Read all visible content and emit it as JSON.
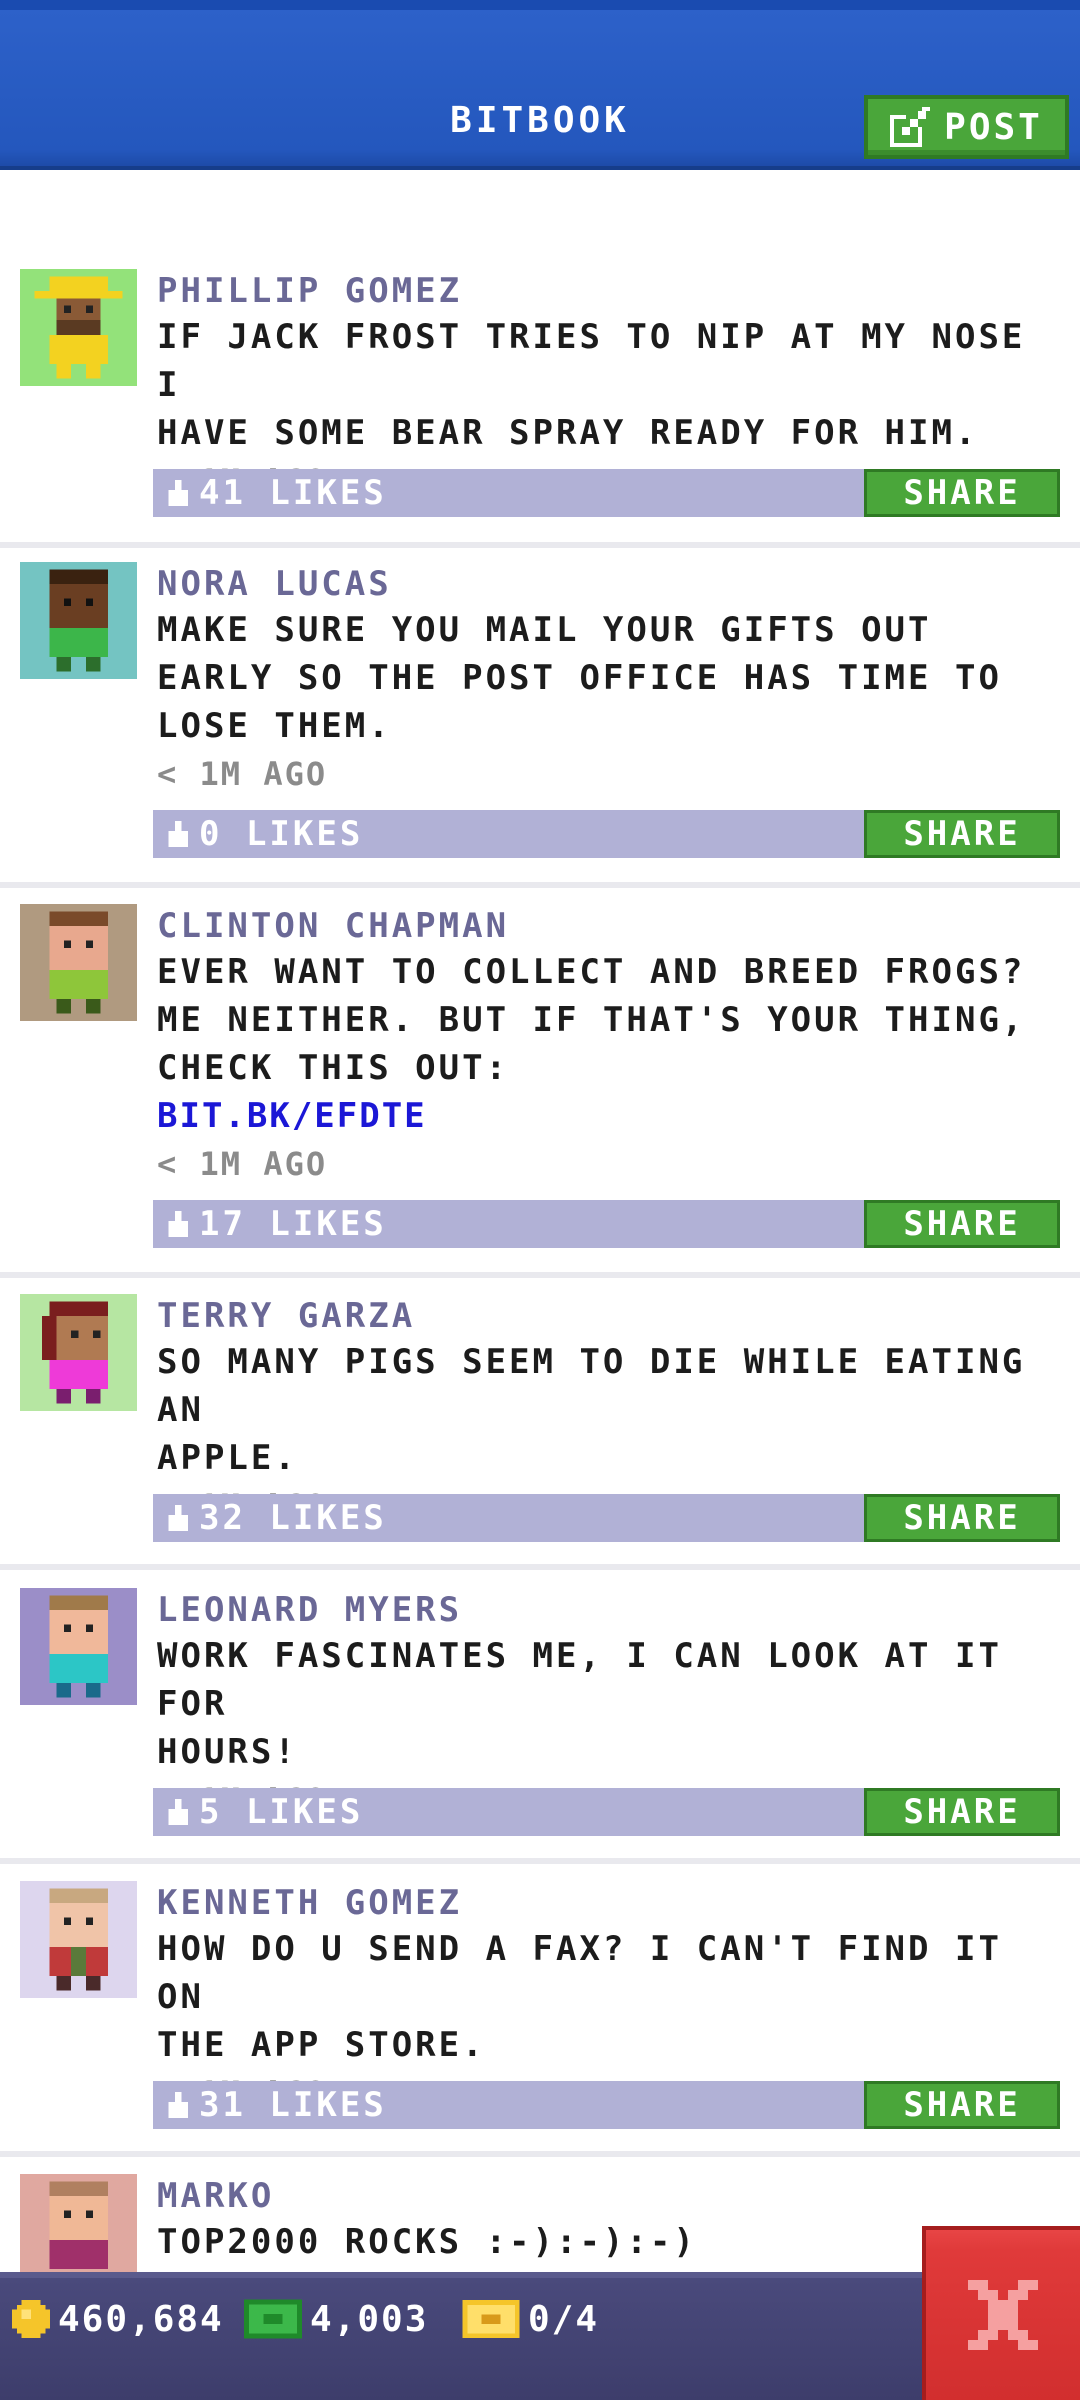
{
  "header": {
    "title": "BITBOOK",
    "post_label": "POST"
  },
  "posts": [
    {
      "name": "PHILLIP GOMEZ",
      "lines": [
        "IF JACK FROST TRIES TO NIP AT MY NOSE I",
        "HAVE SOME BEAR SPRAY READY FOR HIM."
      ],
      "link": "",
      "time": "< 1M AGO",
      "likes": "41 LIKES",
      "share": "SHARE"
    },
    {
      "name": "NORA LUCAS",
      "lines": [
        "MAKE SURE YOU MAIL YOUR GIFTS OUT",
        "EARLY SO THE POST OFFICE HAS TIME TO",
        "LOSE THEM."
      ],
      "link": "",
      "time": "< 1M AGO",
      "likes": "0 LIKES",
      "share": "SHARE"
    },
    {
      "name": "CLINTON CHAPMAN",
      "lines": [
        "EVER WANT TO COLLECT AND BREED FROGS?",
        "ME NEITHER. BUT IF THAT'S YOUR THING,",
        "CHECK THIS OUT:"
      ],
      "link": "BIT.BK/EFDTE",
      "time": "< 1M AGO",
      "likes": "17 LIKES",
      "share": "SHARE"
    },
    {
      "name": "TERRY GARZA",
      "lines": [
        "SO MANY PIGS SEEM TO DIE WHILE EATING AN",
        "APPLE."
      ],
      "link": "",
      "time": "< 1M AGO",
      "likes": "32 LIKES",
      "share": "SHARE"
    },
    {
      "name": "LEONARD MYERS",
      "lines": [
        "WORK FASCINATES ME, I CAN LOOK AT IT FOR",
        "HOURS!"
      ],
      "link": "",
      "time": "< 1M AGO",
      "likes": "5 LIKES",
      "share": "SHARE"
    },
    {
      "name": "KENNETH GOMEZ",
      "lines": [
        "HOW DO U SEND A FAX? I CAN'T FIND IT ON",
        "THE APP STORE."
      ],
      "link": "",
      "time": "< 1M AGO",
      "likes": "31 LIKES",
      "share": "SHARE"
    },
    {
      "name": "MARKO",
      "lines": [
        "TOP2000 ROCKS :-):-):-)"
      ],
      "link": "",
      "time": "",
      "likes": "",
      "share": ""
    }
  ],
  "footer": {
    "coins": "460,684",
    "bux": "4,003",
    "tickets": "0/4"
  },
  "colors": {
    "header_blue": "#2457bd",
    "share_green": "#4aa63a",
    "like_bar": "#b1b1d6",
    "name_purple": "#6a6896",
    "link_blue": "#1b17d6",
    "close_red": "#d12e2e"
  }
}
